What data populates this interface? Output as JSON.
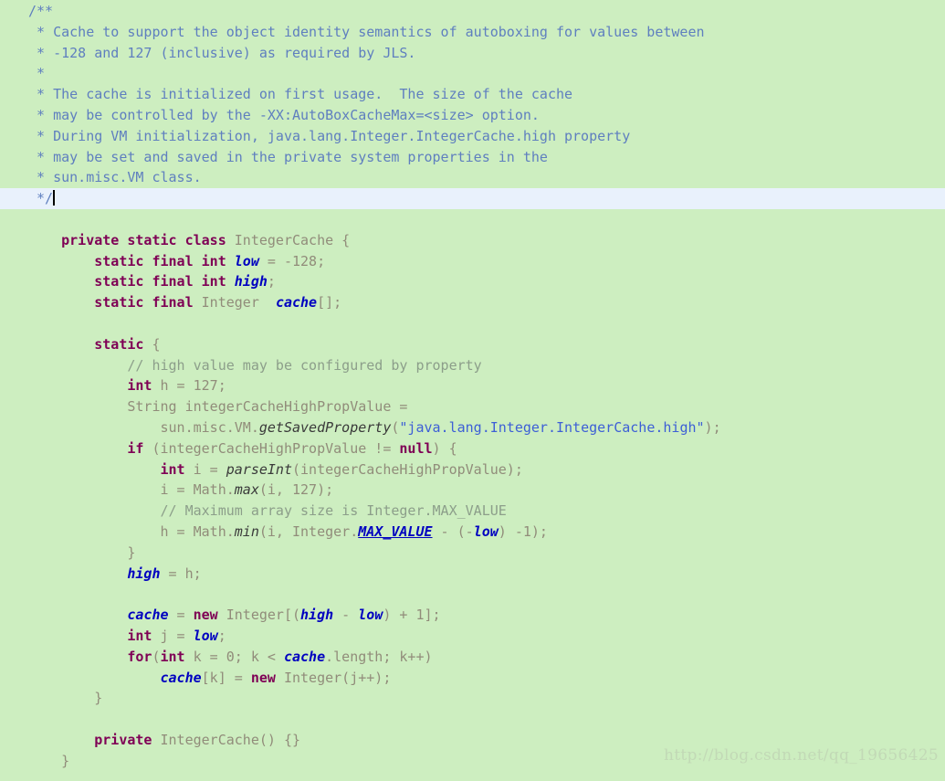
{
  "editor": {
    "language": "java",
    "background_color": "#cdeec0",
    "current_line_highlight_color": "#e9f1fc",
    "current_line_number": 10,
    "caret_visible": true
  },
  "watermark": {
    "text": "http://blog.csdn.net/qq_19656425",
    "color": "#c2d9b6"
  },
  "colors": {
    "javadoc": "#5f7fbf",
    "line_comment": "#8c9e8a",
    "keyword": "#7f0055",
    "identifier": "#918c7a",
    "field": "#0000c0",
    "string": "#3d5fd6",
    "method": "#3a3a3a"
  },
  "code_lines": [
    {
      "n": 1,
      "indent": 1,
      "tokens": [
        {
          "t": "/**",
          "c": "jdoc"
        }
      ]
    },
    {
      "n": 2,
      "indent": 1,
      "tokens": [
        {
          "t": " * Cache to support the object identity semantics of autoboxing for values between",
          "c": "jdoc"
        }
      ]
    },
    {
      "n": 3,
      "indent": 1,
      "tokens": [
        {
          "t": " * -128 and 127 (inclusive) as required by JLS.",
          "c": "jdoc"
        }
      ]
    },
    {
      "n": 4,
      "indent": 1,
      "tokens": [
        {
          "t": " *",
          "c": "jdoc"
        }
      ]
    },
    {
      "n": 5,
      "indent": 1,
      "tokens": [
        {
          "t": " * The cache is initialized on first usage.  The size of the cache",
          "c": "jdoc"
        }
      ]
    },
    {
      "n": 6,
      "indent": 1,
      "tokens": [
        {
          "t": " * may be controlled by the -XX:AutoBoxCacheMax=<size> option.",
          "c": "jdoc"
        }
      ]
    },
    {
      "n": 7,
      "indent": 1,
      "tokens": [
        {
          "t": " * During VM initialization, java.lang.Integer.IntegerCache.high property",
          "c": "jdoc"
        }
      ]
    },
    {
      "n": 8,
      "indent": 1,
      "tokens": [
        {
          "t": " * may be set and saved in the private system properties in the",
          "c": "jdoc"
        }
      ]
    },
    {
      "n": 9,
      "indent": 1,
      "tokens": [
        {
          "t": " * sun.misc.VM class.",
          "c": "jdoc"
        }
      ]
    },
    {
      "n": 10,
      "indent": 1,
      "current": true,
      "caret": true,
      "tokens": [
        {
          "t": " */",
          "c": "jdoc"
        }
      ]
    },
    {
      "n": 11,
      "indent": 0,
      "tokens": []
    },
    {
      "n": 12,
      "indent": 0,
      "tokens": [
        {
          "t": "    private static class ",
          "c": "kw"
        },
        {
          "t": "IntegerCache {",
          "c": "type"
        }
      ]
    },
    {
      "n": 13,
      "indent": 0,
      "tokens": [
        {
          "t": "        static final int ",
          "c": "kw"
        },
        {
          "t": "low",
          "c": "field"
        },
        {
          "t": " = -128;",
          "c": "plain"
        }
      ]
    },
    {
      "n": 14,
      "indent": 0,
      "tokens": [
        {
          "t": "        static final int ",
          "c": "kw"
        },
        {
          "t": "high",
          "c": "field"
        },
        {
          "t": ";",
          "c": "plain"
        }
      ]
    },
    {
      "n": 15,
      "indent": 0,
      "tokens": [
        {
          "t": "        static final ",
          "c": "kw"
        },
        {
          "t": "Integer  ",
          "c": "type"
        },
        {
          "t": "cache",
          "c": "field"
        },
        {
          "t": "[];",
          "c": "plain"
        }
      ]
    },
    {
      "n": 16,
      "indent": 0,
      "tokens": []
    },
    {
      "n": 17,
      "indent": 0,
      "tokens": [
        {
          "t": "        static ",
          "c": "kw"
        },
        {
          "t": "{",
          "c": "plain"
        }
      ]
    },
    {
      "n": 18,
      "indent": 0,
      "tokens": [
        {
          "t": "            // high value may be configured by property",
          "c": "cmt"
        }
      ]
    },
    {
      "n": 19,
      "indent": 0,
      "tokens": [
        {
          "t": "            int ",
          "c": "kw"
        },
        {
          "t": "h = 127;",
          "c": "plain"
        }
      ]
    },
    {
      "n": 20,
      "indent": 0,
      "tokens": [
        {
          "t": "            String integerCacheHighPropValue =",
          "c": "plain"
        }
      ]
    },
    {
      "n": 21,
      "indent": 0,
      "tokens": [
        {
          "t": "                sun.misc.VM.",
          "c": "plain"
        },
        {
          "t": "getSavedProperty",
          "c": "method"
        },
        {
          "t": "(",
          "c": "plain"
        },
        {
          "t": "\"java.lang.Integer.IntegerCache.high\"",
          "c": "str"
        },
        {
          "t": ");",
          "c": "plain"
        }
      ]
    },
    {
      "n": 22,
      "indent": 0,
      "tokens": [
        {
          "t": "            if ",
          "c": "kw"
        },
        {
          "t": "(integerCacheHighPropValue != ",
          "c": "plain"
        },
        {
          "t": "null",
          "c": "kw"
        },
        {
          "t": ") {",
          "c": "plain"
        }
      ]
    },
    {
      "n": 23,
      "indent": 0,
      "tokens": [
        {
          "t": "                int ",
          "c": "kw"
        },
        {
          "t": "i = ",
          "c": "plain"
        },
        {
          "t": "parseInt",
          "c": "method"
        },
        {
          "t": "(integerCacheHighPropValue);",
          "c": "plain"
        }
      ]
    },
    {
      "n": 24,
      "indent": 0,
      "tokens": [
        {
          "t": "                i = Math.",
          "c": "plain"
        },
        {
          "t": "max",
          "c": "method"
        },
        {
          "t": "(i, 127);",
          "c": "plain"
        }
      ]
    },
    {
      "n": 25,
      "indent": 0,
      "tokens": [
        {
          "t": "                // Maximum array size is Integer.MAX_VALUE",
          "c": "cmt"
        }
      ]
    },
    {
      "n": 26,
      "indent": 0,
      "tokens": [
        {
          "t": "                h = Math.",
          "c": "plain"
        },
        {
          "t": "min",
          "c": "method"
        },
        {
          "t": "(i, Integer.",
          "c": "plain"
        },
        {
          "t": "MAX_VALUE",
          "c": "fieldu"
        },
        {
          "t": " - (-",
          "c": "plain"
        },
        {
          "t": "low",
          "c": "field"
        },
        {
          "t": ") -1);",
          "c": "plain"
        }
      ]
    },
    {
      "n": 27,
      "indent": 0,
      "tokens": [
        {
          "t": "            }",
          "c": "plain"
        }
      ]
    },
    {
      "n": 28,
      "indent": 0,
      "tokens": [
        {
          "t": "            ",
          "c": "plain"
        },
        {
          "t": "high",
          "c": "field"
        },
        {
          "t": " = h;",
          "c": "plain"
        }
      ]
    },
    {
      "n": 29,
      "indent": 0,
      "tokens": []
    },
    {
      "n": 30,
      "indent": 0,
      "tokens": [
        {
          "t": "            ",
          "c": "plain"
        },
        {
          "t": "cache",
          "c": "field"
        },
        {
          "t": " = ",
          "c": "plain"
        },
        {
          "t": "new ",
          "c": "kw"
        },
        {
          "t": "Integer[(",
          "c": "plain"
        },
        {
          "t": "high",
          "c": "field"
        },
        {
          "t": " - ",
          "c": "plain"
        },
        {
          "t": "low",
          "c": "field"
        },
        {
          "t": ") + 1];",
          "c": "plain"
        }
      ]
    },
    {
      "n": 31,
      "indent": 0,
      "tokens": [
        {
          "t": "            int ",
          "c": "kw"
        },
        {
          "t": "j = ",
          "c": "plain"
        },
        {
          "t": "low",
          "c": "field"
        },
        {
          "t": ";",
          "c": "plain"
        }
      ]
    },
    {
      "n": 32,
      "indent": 0,
      "tokens": [
        {
          "t": "            for",
          "c": "kw"
        },
        {
          "t": "(",
          "c": "plain"
        },
        {
          "t": "int ",
          "c": "kw"
        },
        {
          "t": "k = 0; k < ",
          "c": "plain"
        },
        {
          "t": "cache",
          "c": "field"
        },
        {
          "t": ".length; k++)",
          "c": "plain"
        }
      ]
    },
    {
      "n": 33,
      "indent": 0,
      "tokens": [
        {
          "t": "                ",
          "c": "plain"
        },
        {
          "t": "cache",
          "c": "field"
        },
        {
          "t": "[k] = ",
          "c": "plain"
        },
        {
          "t": "new ",
          "c": "kw"
        },
        {
          "t": "Integer(j++);",
          "c": "plain"
        }
      ]
    },
    {
      "n": 34,
      "indent": 0,
      "tokens": [
        {
          "t": "        }",
          "c": "plain"
        }
      ]
    },
    {
      "n": 35,
      "indent": 0,
      "tokens": []
    },
    {
      "n": 36,
      "indent": 0,
      "tokens": [
        {
          "t": "        private ",
          "c": "kw"
        },
        {
          "t": "IntegerCache() {}",
          "c": "plain"
        }
      ]
    },
    {
      "n": 37,
      "indent": 0,
      "tokens": [
        {
          "t": "    }",
          "c": "plain"
        }
      ]
    }
  ]
}
